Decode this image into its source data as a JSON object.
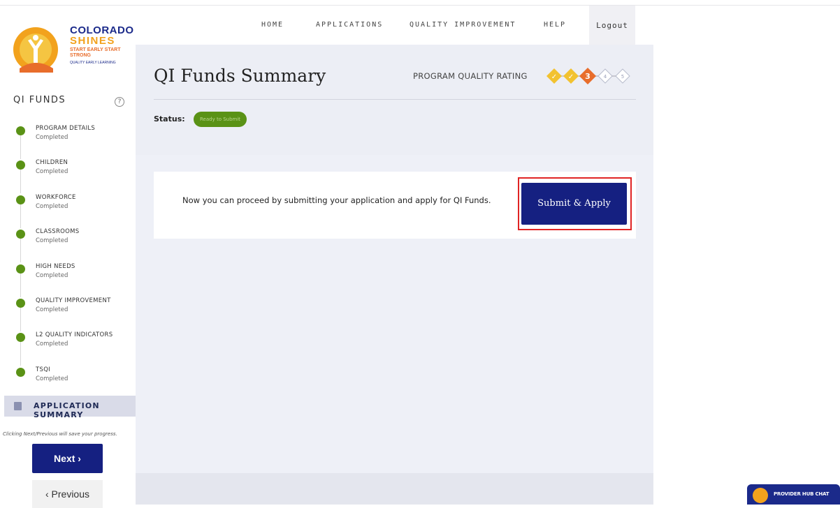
{
  "brand": {
    "line1": "COLORADO",
    "line2": "SHINES",
    "line3": "START EARLY START STRONG",
    "line4": "QUALITY EARLY LEARNING"
  },
  "nav": {
    "home": "HOME",
    "applications": "APPLICATIONS",
    "quality_improvement": "QUALITY IMPROVEMENT",
    "help": "HELP",
    "logout": "Logout"
  },
  "sidebar": {
    "title": "QI FUNDS",
    "help_icon": "?",
    "steps": [
      {
        "label": "PROGRAM DETAILS",
        "status": "Completed"
      },
      {
        "label": "CHILDREN",
        "status": "Completed"
      },
      {
        "label": "WORKFORCE",
        "status": "Completed"
      },
      {
        "label": "CLASSROOMS",
        "status": "Completed"
      },
      {
        "label": "HIGH NEEDS",
        "status": "Completed"
      },
      {
        "label": "QUALITY IMPROVEMENT",
        "status": "Completed"
      },
      {
        "label": "L2 QUALITY INDICATORS",
        "status": "Completed"
      },
      {
        "label": "TSQI",
        "status": "Completed"
      }
    ],
    "active_item": "APPLICATION SUMMARY",
    "hint": "Clicking Next/Previous will save your progress.",
    "next_label": "Next ›",
    "previous_label": "‹ Previous"
  },
  "header": {
    "title": "QI Funds Summary",
    "rating_label": "PROGRAM QUALITY RATING",
    "rating_levels": [
      "✓",
      "✓",
      "3",
      "4",
      "5"
    ],
    "current_level": 3,
    "status_label": "Status:",
    "status_value": "Ready to Submit"
  },
  "main": {
    "message": "Now you can proceed by submitting your application and apply for QI Funds.",
    "submit_label": "Submit & Apply"
  },
  "chat": {
    "label": "PROVIDER HUB CHAT"
  },
  "colors": {
    "primary": "#152081",
    "complete": "#5a9216",
    "rating_gold": "#f2c230",
    "rating_current": "#e86d2b",
    "highlight_border": "#e02424"
  }
}
